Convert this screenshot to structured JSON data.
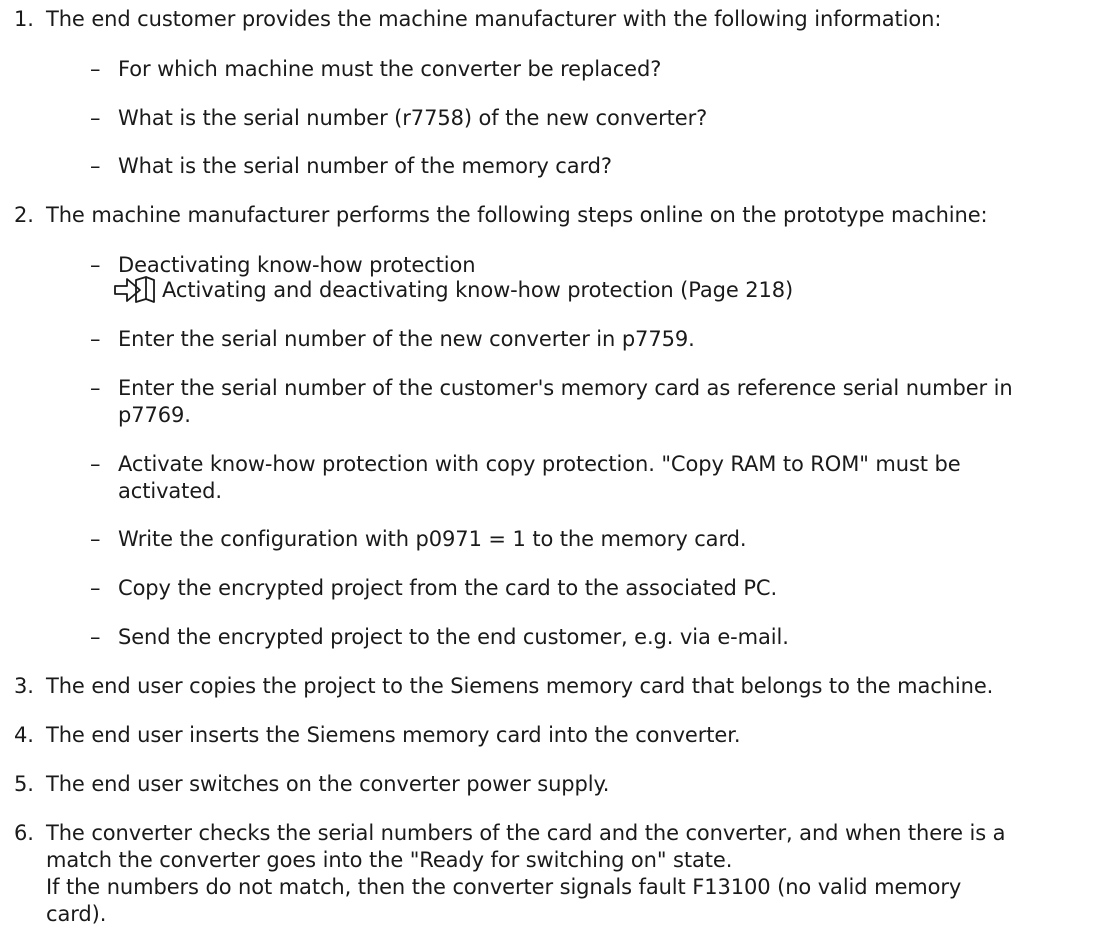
{
  "steps": [
    {
      "number": "1.",
      "text": "The end customer provides the machine manufacturer with the following information:",
      "items": [
        "For which machine must the converter be replaced?",
        "What is the serial number (r7758) of the new converter?",
        "What is the serial number of the memory card?"
      ]
    },
    {
      "number": "2.",
      "text": "The machine manufacturer performs the following steps online on the prototype machine:",
      "items": [
        "Deactivating know-how protection",
        "Enter the serial number of the new converter in p7759.",
        "Enter the serial number of the customer's memory card as reference serial number in",
        "p7769.",
        "Activate know-how protection with copy protection. \"Copy RAM to ROM\" must be",
        "activated.",
        "Write the configuration with p0971 = 1 to the memory card.",
        "Copy the encrypted project from the card to the associated PC.",
        "Send the encrypted project to the end customer, e.g. via e-mail."
      ],
      "link": "Activating and deactivating know-how protection (Page 218)"
    },
    {
      "number": "3.",
      "text": "The end user copies the project to the Siemens memory card that belongs to the machine."
    },
    {
      "number": "4.",
      "text": "The end user inserts the Siemens memory card into the converter."
    },
    {
      "number": "5.",
      "text": "The end user switches on the converter power supply."
    },
    {
      "number": "6.",
      "lines": [
        "The converter checks the serial numbers of the card and the converter, and when there is a",
        "match the converter goes into the \"Ready for switching on\" state.",
        "If the numbers do not match, then the converter signals fault F13100 (no valid memory",
        "card)."
      ]
    }
  ],
  "dash_symbol": "–",
  "icon": "cross-reference-book-icon"
}
